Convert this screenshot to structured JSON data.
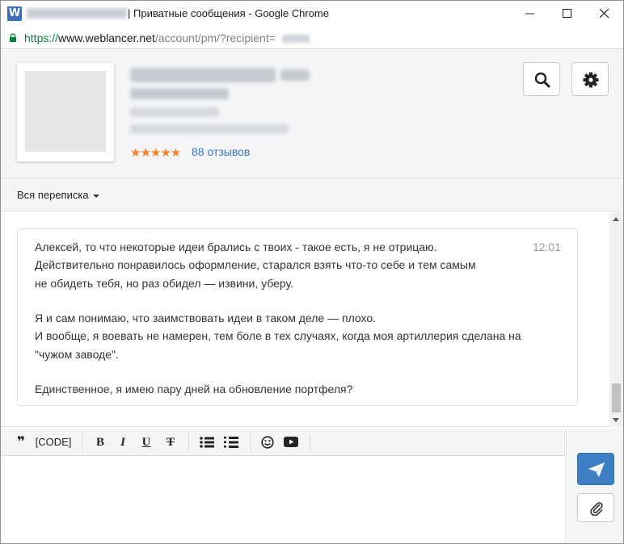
{
  "window": {
    "title": "| Приватные сообщения - Google Chrome",
    "favicon_letter": "W"
  },
  "address_bar": {
    "scheme": "https://",
    "host": "www.weblancer.net",
    "path": "/account/pm/?recipient="
  },
  "profile": {
    "rating_stars": "★★★★★",
    "reviews_label": "88 отзывов"
  },
  "filter": {
    "label": "Вся переписка"
  },
  "message": {
    "time": "12:01",
    "lines": [
      "Алексей, то что некоторые идеи брались с твоих - такое есть, я не отрицаю.",
      "Действительно понравилось оформление, старался взять что-то себе и тем самым",
      "не обидеть тебя, но раз обидел — извини, уберу.",
      "Я и сам понимаю, что заимствовать идеи в таком деле — плохо.",
      "И вообще, я воевать не намерен, тем боле в тех случаях, когда моя артиллерия сделана на",
      "\"чужом заводе\".",
      "Единственное, я имею пару дней на обновление портфеля?"
    ]
  },
  "editor": {
    "quote_glyph": "❞",
    "code_label": "[CODE]",
    "bold_label": "B",
    "italic_label": "I",
    "underline_label": "U",
    "strike_label": "T"
  },
  "colors": {
    "accent": "#3f7fc5",
    "link": "#3a78bd",
    "stars": "#f5822a",
    "secure": "#0b8043"
  }
}
